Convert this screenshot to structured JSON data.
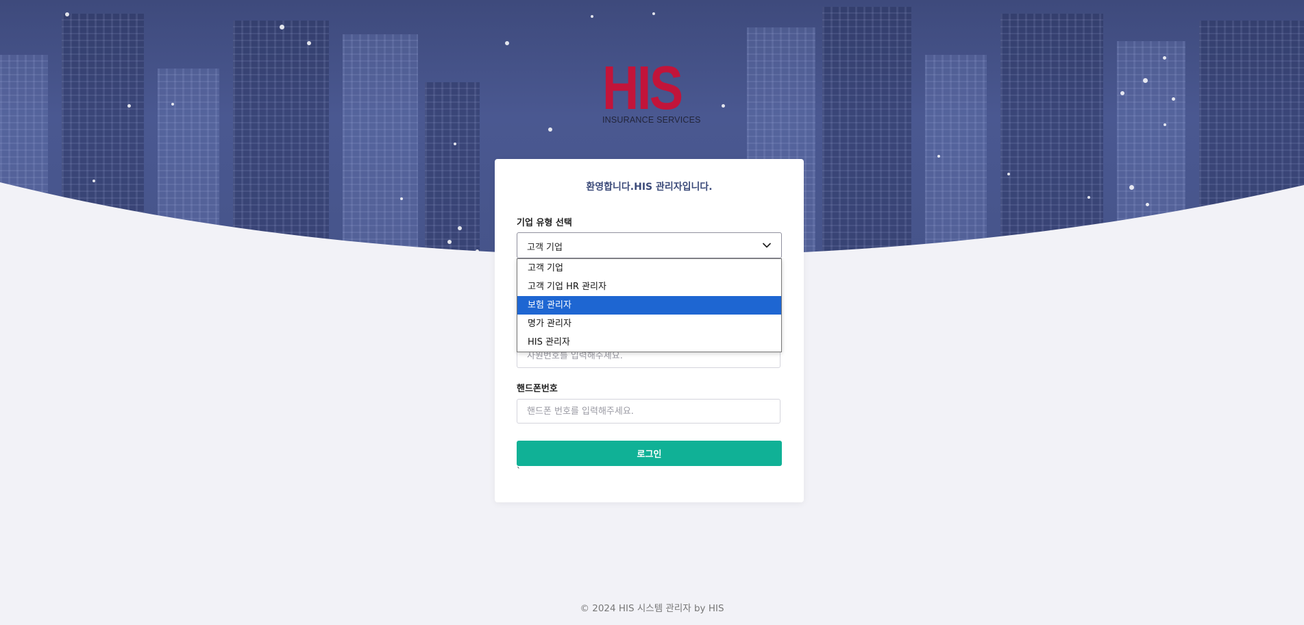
{
  "brand": {
    "logo_text": "HIS",
    "logo_subtitle": "INSURANCE SERVICES",
    "logo_color": "#c2143a"
  },
  "card": {
    "welcome": "환영합니다.HIS 관리자입니다.",
    "company_type": {
      "label": "기업 유형 선택",
      "selected": "고객 기업",
      "options": [
        {
          "label": "고객 기업",
          "highlighted": false
        },
        {
          "label": "고객 기업 HR 관리자",
          "highlighted": false
        },
        {
          "label": "보험 관리자",
          "highlighted": true
        },
        {
          "label": "명가 관리자",
          "highlighted": false
        },
        {
          "label": "HIS 관리자",
          "highlighted": false
        }
      ]
    },
    "employee_number": {
      "placeholder": "사원번호를 입력해주세요."
    },
    "phone": {
      "label": "핸드폰번호",
      "placeholder": "핸드폰 번호를 입력해주세요."
    },
    "login_label": "로그인",
    "stray_char": "`"
  },
  "footer": {
    "copyright": "© 2024 HIS 시스템 관리자 by HIS"
  },
  "colors": {
    "primary_button": "#10b196",
    "hero": "#4a5891",
    "highlight": "#1e66d2",
    "page_bg": "#f2f2f7"
  }
}
